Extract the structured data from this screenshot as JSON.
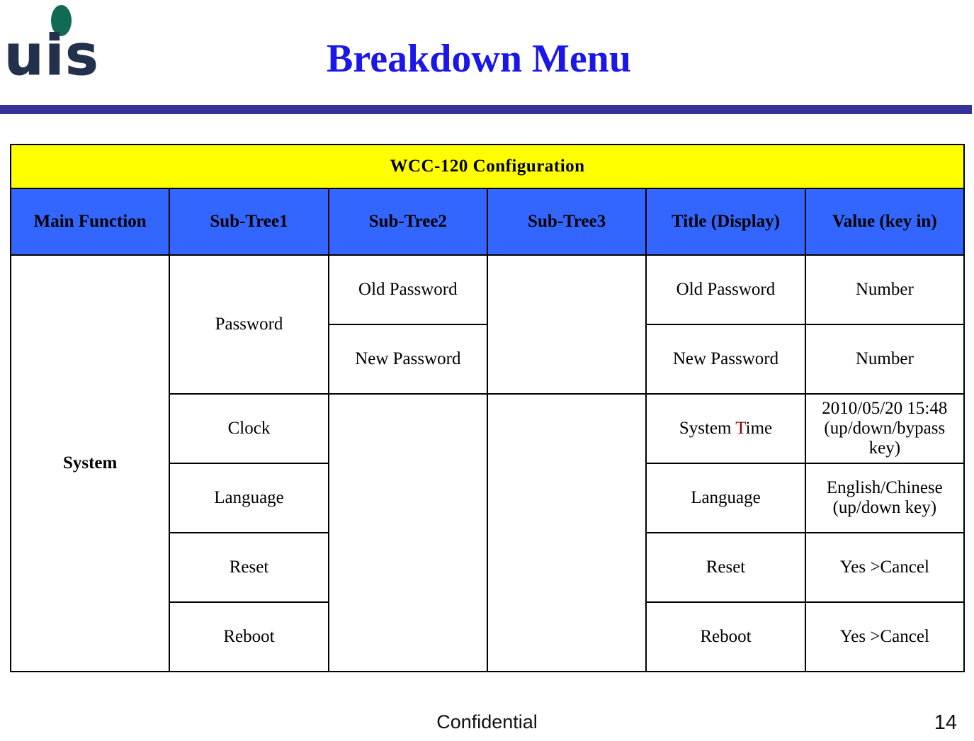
{
  "header": {
    "logo_text": "uis",
    "logo_icon": "uis-logo",
    "logo_dot_color": "#116B54",
    "logo_text_color": "#23314D",
    "title": "Breakdown Menu",
    "title_color": "#1A17E8",
    "rule_color": "#333399"
  },
  "table": {
    "caption": "WCC-120 Configuration",
    "caption_bg": "#FFFF00",
    "header_bg": "#3366FF",
    "columns": [
      "Main Function",
      "Sub-Tree1",
      "Sub-Tree2",
      "Sub-Tree3",
      "Title (Display)",
      "Value (key in)"
    ],
    "main_function": "System",
    "rows": [
      {
        "sub_tree1": "Password",
        "sub_tree2": "Old Password",
        "sub_tree3": "",
        "title_display": "Old Password",
        "value_key_in": "Number"
      },
      {
        "sub_tree1": "",
        "sub_tree2": "New Password",
        "sub_tree3": "",
        "title_display": "New Password",
        "value_key_in": "Number"
      },
      {
        "sub_tree1": "Clock",
        "sub_tree2": "",
        "sub_tree3": "",
        "title_display_prefix": "System ",
        "title_display_accent": "T",
        "title_display_suffix": "ime",
        "title_display": "System Time",
        "value_key_in": "2010/05/20 15:48 (up/down/bypass key)"
      },
      {
        "sub_tree1": "Language",
        "sub_tree2": "",
        "sub_tree3": "",
        "title_display": "Language",
        "value_key_in": "English/Chinese (up/down key)"
      },
      {
        "sub_tree1": "Reset",
        "sub_tree2": "",
        "sub_tree3": "",
        "title_display": "Reset",
        "value_key_in": "Yes >Cancel"
      },
      {
        "sub_tree1": "Reboot",
        "sub_tree2": "",
        "sub_tree3": "",
        "title_display": "Reboot",
        "value_key_in": "Yes >Cancel"
      }
    ]
  },
  "footer": {
    "confidential": "Confidential",
    "page_number": "14"
  }
}
